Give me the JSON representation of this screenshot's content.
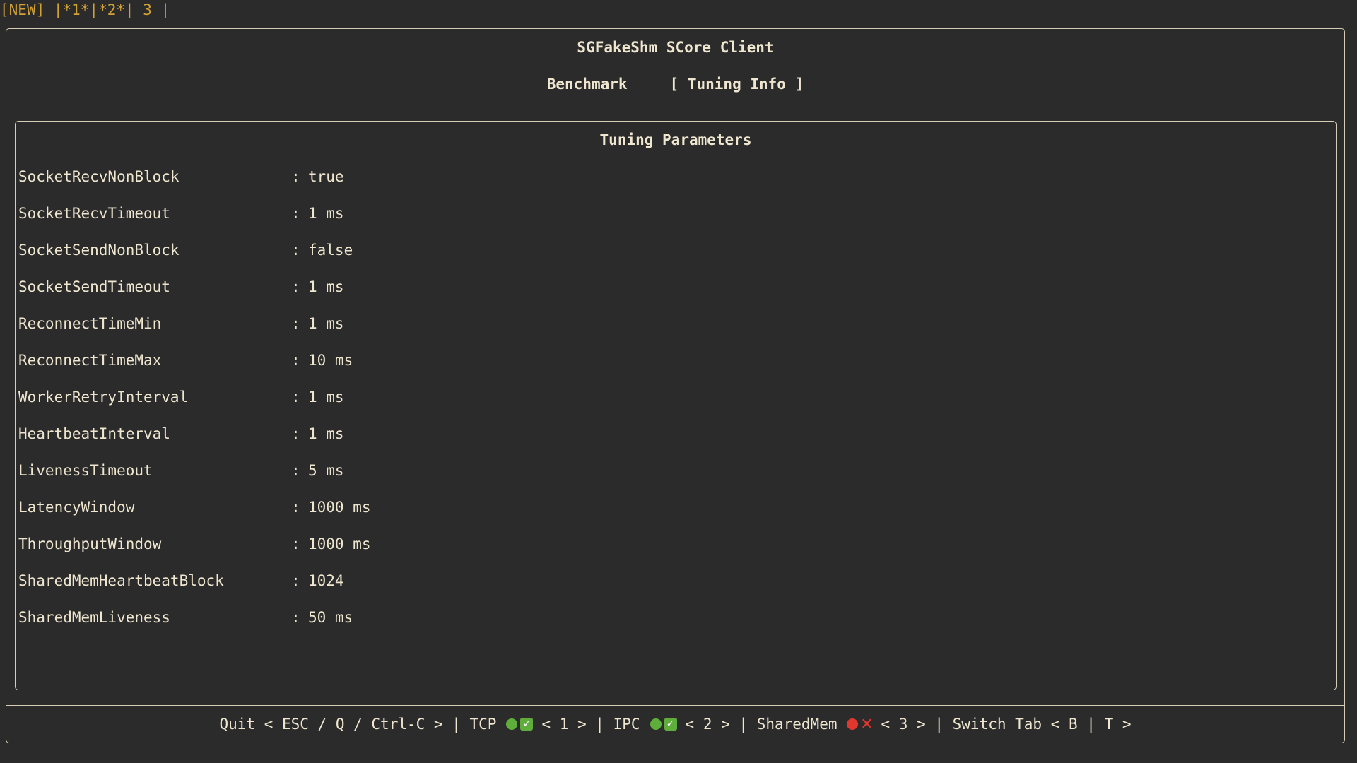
{
  "tmux_status": "[NEW] |*1*|*2*| 3 |",
  "app_title": "SGFakeShm SCore Client",
  "tabs": [
    {
      "label": "Benchmark"
    },
    {
      "label": "[ Tuning Info ]"
    }
  ],
  "panel_title": "Tuning Parameters",
  "params": [
    {
      "key": "SocketRecvNonBlock",
      "sep": ":",
      "value": "true"
    },
    {
      "key": "SocketRecvTimeout",
      "sep": ":",
      "value": "1 ms"
    },
    {
      "key": "SocketSendNonBlock",
      "sep": ":",
      "value": "false"
    },
    {
      "key": "SocketSendTimeout",
      "sep": ":",
      "value": "1 ms"
    },
    {
      "key": "ReconnectTimeMin",
      "sep": ":",
      "value": "1 ms"
    },
    {
      "key": "ReconnectTimeMax",
      "sep": ":",
      "value": "10 ms"
    },
    {
      "key": "WorkerRetryInterval",
      "sep": ":",
      "value": "1 ms"
    },
    {
      "key": "HeartbeatInterval",
      "sep": ":",
      "value": "1 ms"
    },
    {
      "key": "LivenessTimeout",
      "sep": ":",
      "value": "5 ms"
    },
    {
      "key": "LatencyWindow",
      "sep": ":",
      "value": "1000 ms"
    },
    {
      "key": "ThroughputWindow",
      "sep": ":",
      "value": "1000 ms"
    },
    {
      "key": "SharedMemHeartbeatBlock",
      "sep": ":",
      "value": "1024"
    },
    {
      "key": "SharedMemLiveness",
      "sep": ":",
      "value": "50 ms"
    }
  ],
  "footer": {
    "quit": "Quit < ESC / Q / Ctrl-C > | ",
    "tcp_label": "TCP",
    "tcp_key": "< 1 > | ",
    "ipc_label": "IPC",
    "ipc_key": "< 2 > | ",
    "shm_label": "SharedMem",
    "shm_key": "< 3 > | ",
    "switch": "Switch Tab < B | T >",
    "check_glyph": "✓",
    "cross_glyph": "✕"
  },
  "colors": {
    "background": "#2b2b2b",
    "text": "#efe6cf",
    "tmux_status": "#d3a235",
    "status_ok": "#5fae3b",
    "status_error": "#e2372f"
  },
  "icons": {
    "tcp_status": [
      "green-dot-icon",
      "check-icon"
    ],
    "ipc_status": [
      "green-dot-icon",
      "check-icon"
    ],
    "shm_status": [
      "red-dot-icon",
      "cross-icon"
    ]
  }
}
